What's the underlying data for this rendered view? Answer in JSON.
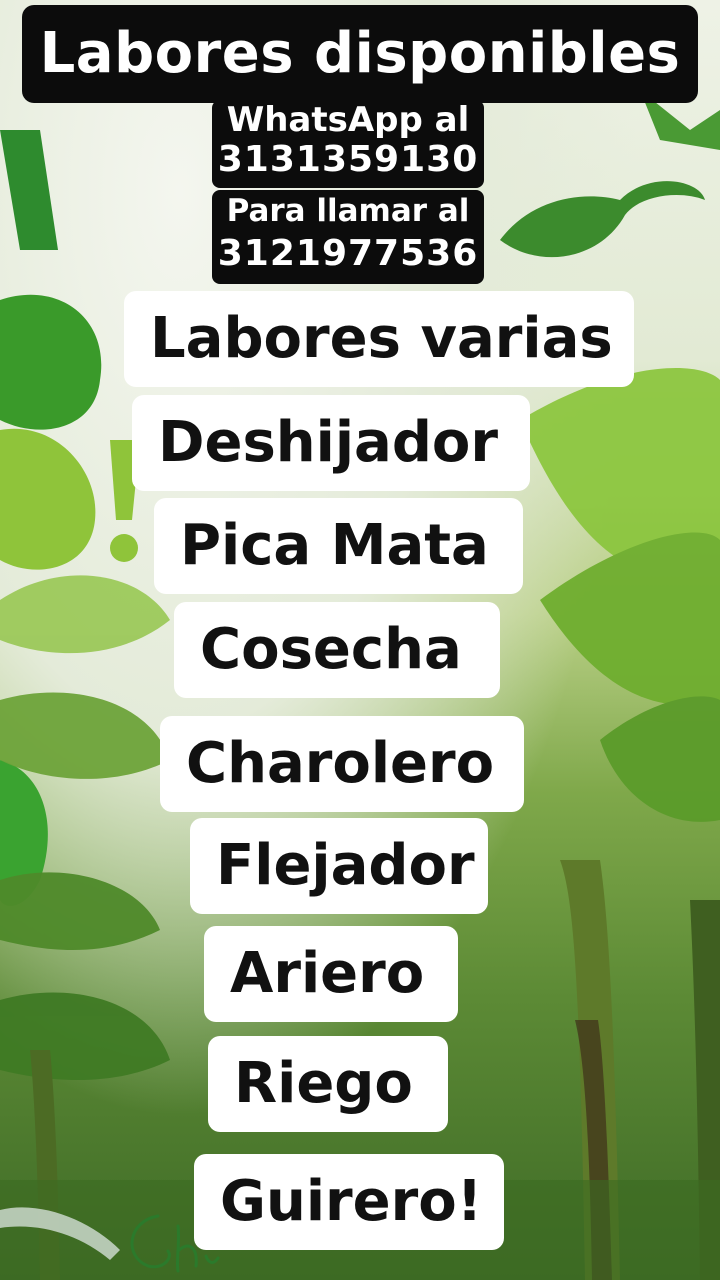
{
  "header": {
    "title": "Labores disponibles"
  },
  "contacts": {
    "whatsapp_label": "WhatsApp al",
    "whatsapp_number": "3131359130",
    "call_label": "Para llamar al",
    "call_number": "3121977536"
  },
  "jobs": [
    "Labores varias",
    "Deshijador",
    "Pica Mata",
    "Cosecha",
    "Charolero",
    "Flejador",
    "Ariero",
    "Riego",
    "Guirero!"
  ],
  "background": {
    "description_icons": [
      "banana-plantation-photo",
      "green-logo-text"
    ],
    "accent_dark_green": "#2e7d32",
    "accent_lime": "#8bc34a"
  }
}
